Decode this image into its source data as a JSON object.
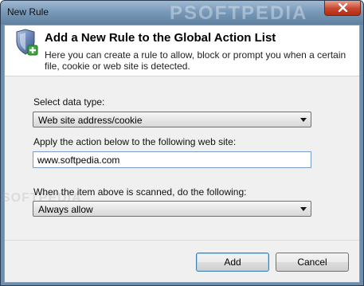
{
  "window": {
    "title": "New Rule",
    "watermark": "PSOFTPEDIA"
  },
  "header": {
    "title": "Add a New Rule to the Global Action List",
    "description": "Here you can create a rule to allow, block or prompt you when a certain file, cookie or web site is detected."
  },
  "form": {
    "data_type_label": "Select data type:",
    "data_type_value": "Web site address/cookie",
    "site_label": "Apply the action below to the following web site:",
    "site_value": "www.softpedia.com",
    "action_label": "When the item above is scanned, do the following:",
    "action_value": "Always allow",
    "side_watermark": "SOFTPEDIA"
  },
  "buttons": {
    "add": "Add",
    "cancel": "Cancel"
  },
  "icons": {
    "close": "close-icon",
    "shield": "shield-add-icon"
  }
}
